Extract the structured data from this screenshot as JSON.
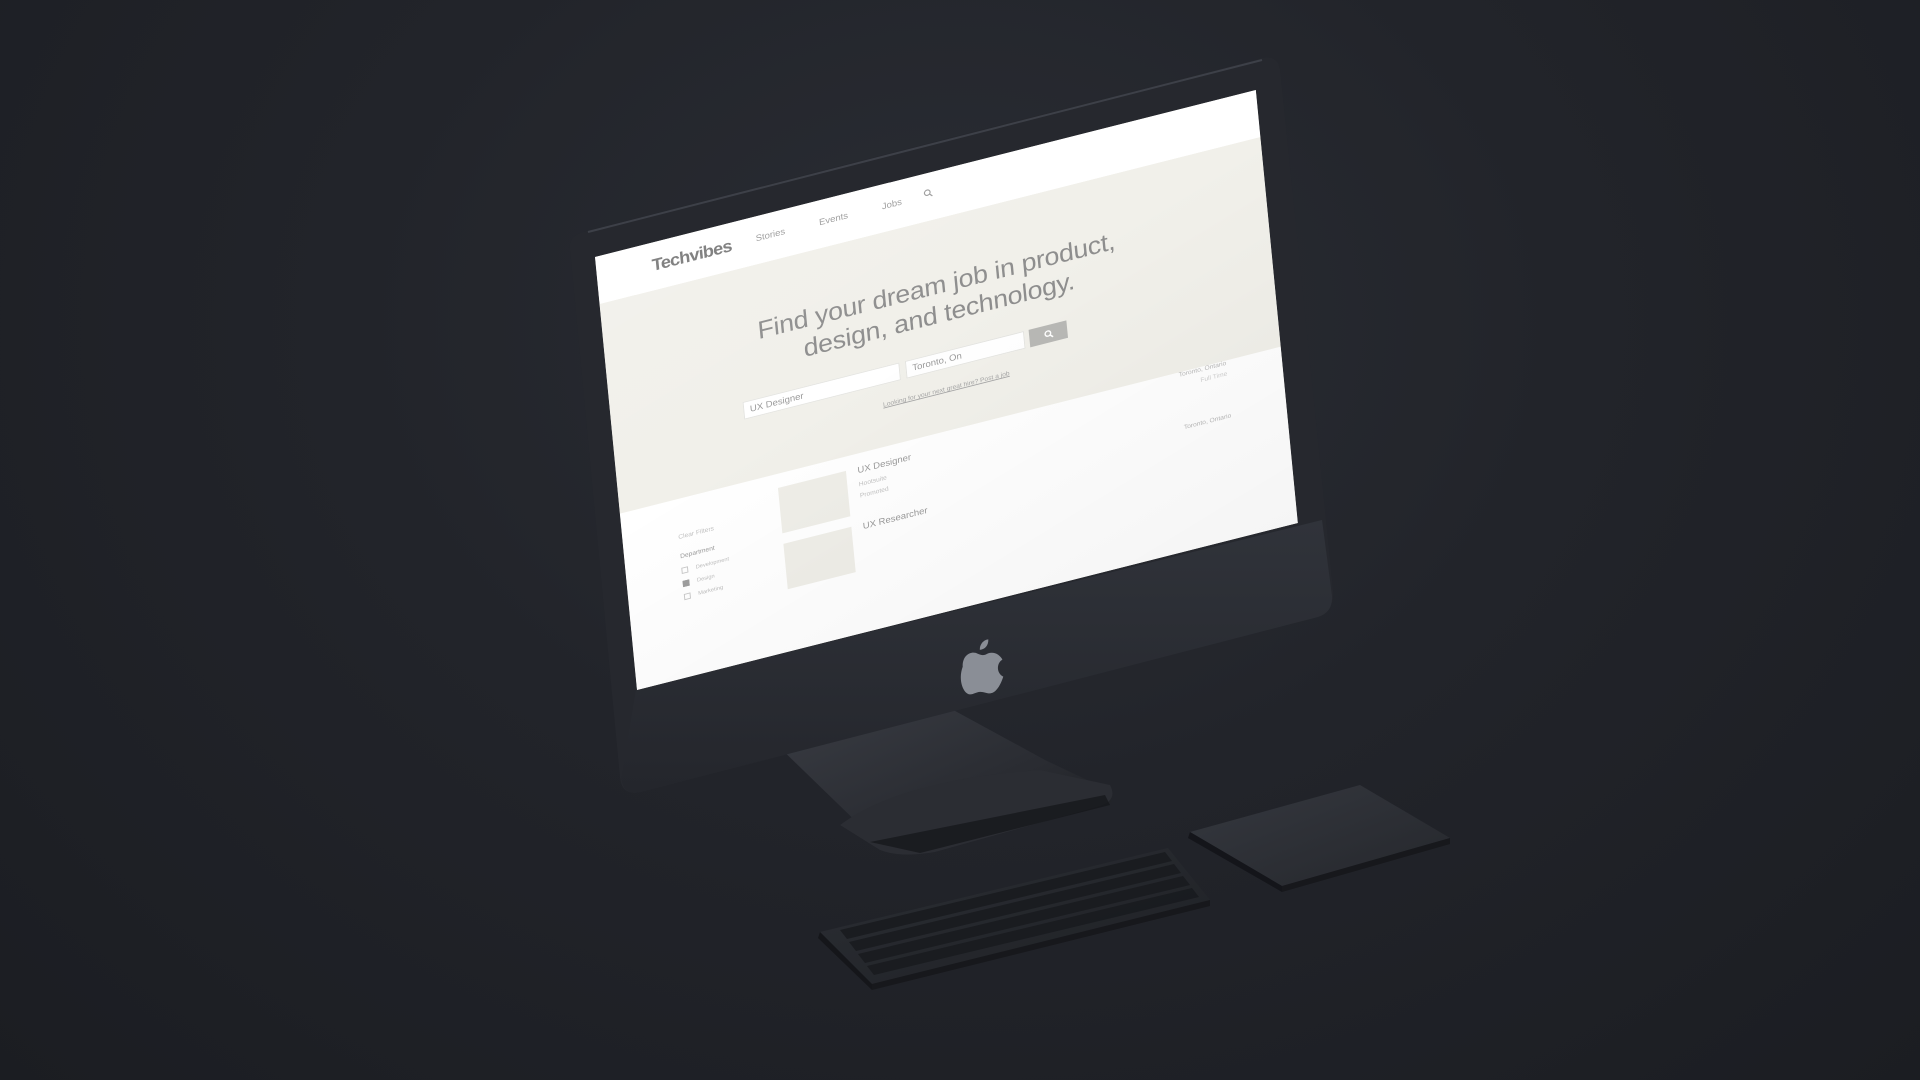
{
  "site": {
    "logo": "Techvibes",
    "nav": [
      "Stories",
      "Events",
      "Jobs"
    ],
    "nav_search_icon": "search-icon"
  },
  "hero": {
    "title_line1": "Find your dream job in product,",
    "title_line2": "design, and technology.",
    "job_field_value": "UX Designer",
    "location_field_value": "Toronto, On",
    "search_button_icon": "search-icon",
    "post_link": "Looking for your next great hire? Post a job"
  },
  "filters": {
    "clear": "Clear Filters",
    "department_title": "Department",
    "options": [
      {
        "label": "Development",
        "checked": false
      },
      {
        "label": "Design",
        "checked": true
      },
      {
        "label": "Marketing",
        "checked": false
      }
    ]
  },
  "jobs": [
    {
      "title": "UX Designer",
      "company": "Hootsuite",
      "tag": "Promoted",
      "location": "Toronto, Ontario",
      "type": "Full Time"
    },
    {
      "title": "UX Researcher",
      "location": "Toronto, Ontario"
    }
  ],
  "colors": {
    "background": "#1f2127",
    "device_body": "#25272d",
    "screen_bg": "#f1f0ea",
    "search_button": "#b8b8b5"
  }
}
